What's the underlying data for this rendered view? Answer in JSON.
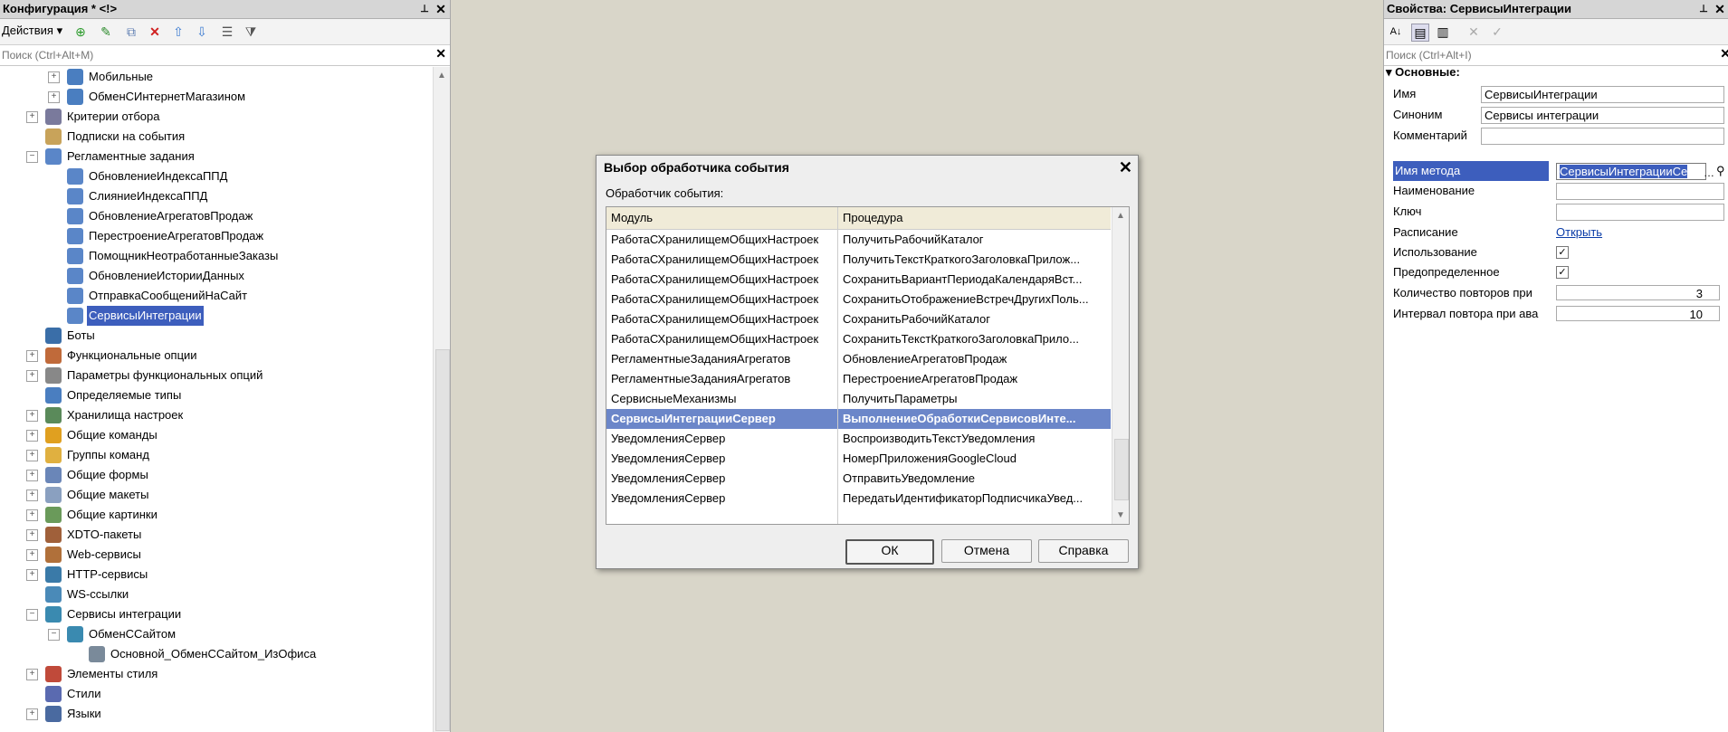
{
  "left": {
    "title": "Конфигурация * <!>",
    "actions_label": "Действия",
    "search_placeholder": "Поиск (Ctrl+Alt+M)",
    "tree": [
      {
        "level": 2,
        "expand": "plus",
        "label": "Мобильные",
        "icon": "exchange-icon",
        "color": "#4a7ec0"
      },
      {
        "level": 2,
        "expand": "plus",
        "label": "ОбменСИнтернетМагазином",
        "icon": "exchange-icon",
        "color": "#4a7ec0"
      },
      {
        "level": 1,
        "expand": "plus",
        "label": "Критерии отбора",
        "icon": "filter-criteria-icon",
        "color": "#7a7a9c"
      },
      {
        "level": 1,
        "expand": "none",
        "label": "Подписки на события",
        "icon": "event-subscription-icon",
        "color": "#c8a35a"
      },
      {
        "level": 1,
        "expand": "minus",
        "label": "Регламентные задания",
        "icon": "clock-icon",
        "color": "#5a86c8"
      },
      {
        "level": 2,
        "expand": "none",
        "label": "ОбновлениеИндексаППД",
        "icon": "clock-icon",
        "color": "#5a86c8"
      },
      {
        "level": 2,
        "expand": "none",
        "label": "СлияниеИндексаППД",
        "icon": "clock-icon",
        "color": "#5a86c8"
      },
      {
        "level": 2,
        "expand": "none",
        "label": "ОбновлениеАгрегатовПродаж",
        "icon": "clock-icon",
        "color": "#5a86c8"
      },
      {
        "level": 2,
        "expand": "none",
        "label": "ПерестроениеАгрегатовПродаж",
        "icon": "clock-icon",
        "color": "#5a86c8"
      },
      {
        "level": 2,
        "expand": "none",
        "label": "ПомощникНеотработанныеЗаказы",
        "icon": "clock-icon",
        "color": "#5a86c8"
      },
      {
        "level": 2,
        "expand": "none",
        "label": "ОбновлениеИсторииДанных",
        "icon": "clock-icon",
        "color": "#5a86c8"
      },
      {
        "level": 2,
        "expand": "none",
        "label": "ОтправкаСообщенийНаСайт",
        "icon": "clock-icon",
        "color": "#5a86c8"
      },
      {
        "level": 2,
        "expand": "none",
        "label": "СервисыИнтеграции",
        "icon": "clock-icon",
        "color": "#5a86c8",
        "selected": true
      },
      {
        "level": 1,
        "expand": "none",
        "label": "Боты",
        "icon": "bot-icon",
        "color": "#3a6ea8"
      },
      {
        "level": 1,
        "expand": "plus",
        "label": "Функциональные опции",
        "icon": "functional-options-icon",
        "color": "#c06a3a"
      },
      {
        "level": 1,
        "expand": "plus",
        "label": "Параметры функциональных опций",
        "icon": "functional-option-params-icon",
        "color": "#888888"
      },
      {
        "level": 1,
        "expand": "none",
        "label": "Определяемые типы",
        "icon": "defined-types-icon",
        "color": "#4a7ec0"
      },
      {
        "level": 1,
        "expand": "plus",
        "label": "Хранилища настроек",
        "icon": "settings-storage-icon",
        "color": "#5a8a5a"
      },
      {
        "level": 1,
        "expand": "plus",
        "label": "Общие команды",
        "icon": "common-commands-icon",
        "color": "#e0a020"
      },
      {
        "level": 1,
        "expand": "plus",
        "label": "Группы команд",
        "icon": "command-groups-icon",
        "color": "#e0b040"
      },
      {
        "level": 1,
        "expand": "plus",
        "label": "Общие формы",
        "icon": "common-forms-icon",
        "color": "#6a86b8"
      },
      {
        "level": 1,
        "expand": "plus",
        "label": "Общие макеты",
        "icon": "common-templates-icon",
        "color": "#8aa0c0"
      },
      {
        "level": 1,
        "expand": "plus",
        "label": "Общие картинки",
        "icon": "common-pictures-icon",
        "color": "#6a9a5a"
      },
      {
        "level": 1,
        "expand": "plus",
        "label": "XDTO-пакеты",
        "icon": "xdto-packages-icon",
        "color": "#a0603a"
      },
      {
        "level": 1,
        "expand": "plus",
        "label": "Web-сервисы",
        "icon": "web-services-icon",
        "color": "#b0703a"
      },
      {
        "level": 1,
        "expand": "plus",
        "label": "HTTP-сервисы",
        "icon": "http-services-icon",
        "color": "#3a7aa8"
      },
      {
        "level": 1,
        "expand": "none",
        "label": "WS-ссылки",
        "icon": "ws-links-icon",
        "color": "#4a8ab8"
      },
      {
        "level": 1,
        "expand": "minus",
        "label": "Сервисы интеграции",
        "icon": "integration-services-icon",
        "color": "#3a8ab0"
      },
      {
        "level": 2,
        "expand": "minus",
        "label": "ОбменССайтом",
        "icon": "integration-service-icon",
        "color": "#3a8ab0"
      },
      {
        "level": 3,
        "expand": "none",
        "label": "Основной_ОбменССайтом_ИзОфиса",
        "icon": "channel-icon",
        "color": "#7a8a9a"
      },
      {
        "level": 1,
        "expand": "plus",
        "label": "Элементы стиля",
        "icon": "style-elements-icon",
        "color": "#c04a3a"
      },
      {
        "level": 1,
        "expand": "none",
        "label": "Стили",
        "icon": "styles-icon",
        "color": "#5a6ab0"
      },
      {
        "level": 1,
        "expand": "plus",
        "label": "Языки",
        "icon": "languages-icon",
        "color": "#4a6aa0"
      }
    ]
  },
  "dialog": {
    "title": "Выбор обработчика события",
    "label": "Обработчик события:",
    "col_module": "Модуль",
    "col_procedure": "Процедура",
    "rows": [
      {
        "module": "РаботаСХранилищемОбщихНастроек",
        "procedure": "ПолучитьРабочийКаталог"
      },
      {
        "module": "РаботаСХранилищемОбщихНастроек",
        "procedure": "ПолучитьТекстКраткогоЗаголовкаПрилож..."
      },
      {
        "module": "РаботаСХранилищемОбщихНастроек",
        "procedure": "СохранитьВариантПериодаКалендаряВст..."
      },
      {
        "module": "РаботаСХранилищемОбщихНастроек",
        "procedure": "СохранитьОтображениеВстречДругихПоль..."
      },
      {
        "module": "РаботаСХранилищемОбщихНастроек",
        "procedure": "СохранитьРабочийКаталог"
      },
      {
        "module": "РаботаСХранилищемОбщихНастроек",
        "procedure": "СохранитьТекстКраткогоЗаголовкаПрило..."
      },
      {
        "module": "РегламентныеЗаданияАгрегатов",
        "procedure": "ОбновлениеАгрегатовПродаж"
      },
      {
        "module": "РегламентныеЗаданияАгрегатов",
        "procedure": "ПерестроениеАгрегатовПродаж"
      },
      {
        "module": "СервисныеМеханизмы",
        "procedure": "ПолучитьПараметры"
      },
      {
        "module": "СервисыИнтеграцииСервер",
        "procedure": "ВыполнениеОбработкиСервисовИнте...",
        "selected": true
      },
      {
        "module": "УведомленияСервер",
        "procedure": "ВоспроизводитьТекстУведомления"
      },
      {
        "module": "УведомленияСервер",
        "procedure": "НомерПриложенияGoogleCloud"
      },
      {
        "module": "УведомленияСервер",
        "procedure": "ОтправитьУведомление"
      },
      {
        "module": "УведомленияСервер",
        "procedure": "ПередатьИдентификаторПодписчикаУвед..."
      }
    ],
    "ok": "ОК",
    "cancel": "Отмена",
    "help": "Справка"
  },
  "right": {
    "title": "Свойства: СервисыИнтеграции",
    "search_placeholder": "Поиск (Ctrl+Alt+I)",
    "section": "Основные:",
    "name_label": "Имя",
    "name_value": "СервисыИнтеграции",
    "synonym_label": "Синоним",
    "synonym_value": "Сервисы интеграции",
    "comment_label": "Комментарий",
    "method_label": "Имя метода",
    "method_value": "СервисыИнтеграцииСе",
    "naimenovanie_label": "Наименование",
    "key_label": "Ключ",
    "schedule_label": "Расписание",
    "schedule_link": "Открыть",
    "use_label": "Использование",
    "predefined_label": "Предопределенное",
    "retry_count_label": "Количество повторов при",
    "retry_count_value": "3",
    "retry_interval_label": "Интервал повтора при ава",
    "retry_interval_value": "10"
  }
}
